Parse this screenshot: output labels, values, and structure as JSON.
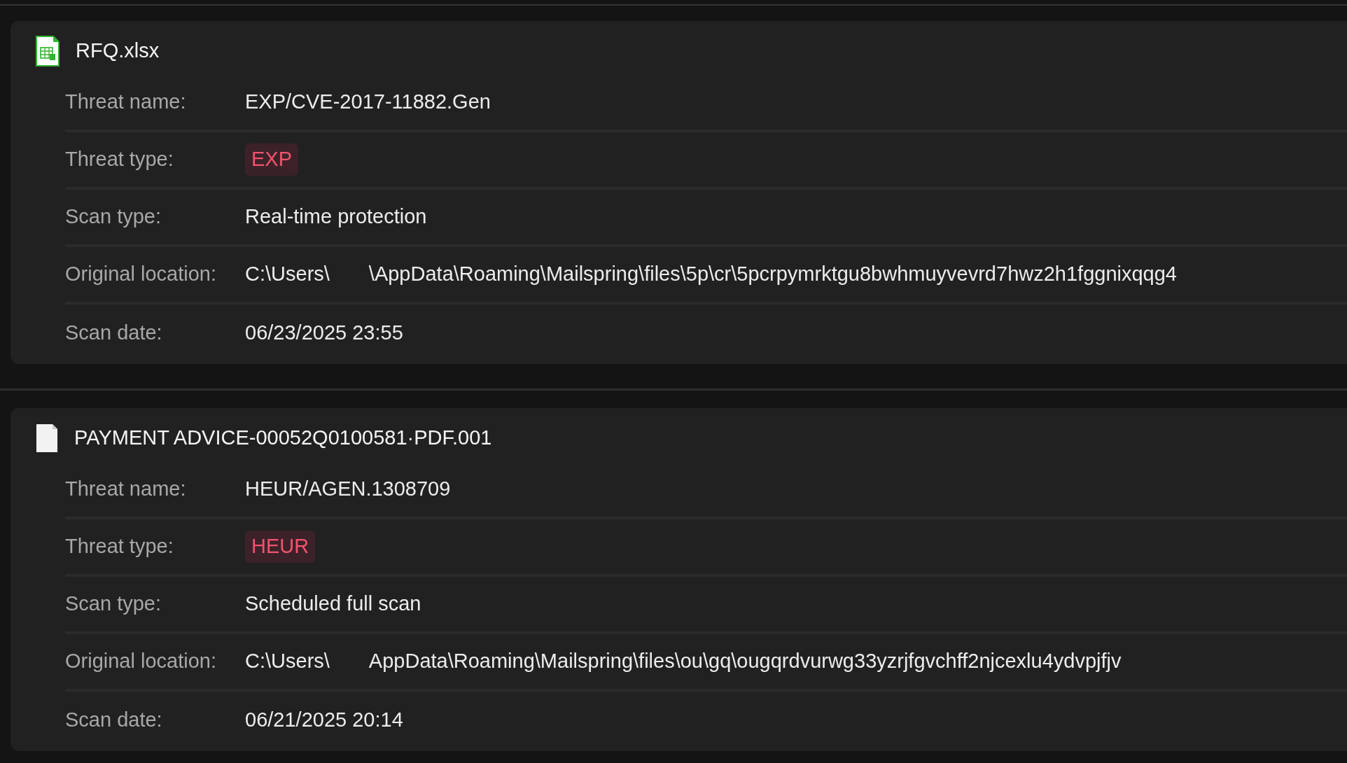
{
  "items": [
    {
      "file_name": "RFQ.xlsx",
      "kind": "spreadsheet",
      "fields": [
        {
          "label": "Threat name:",
          "kind": "text",
          "value": "EXP/CVE-2017-11882.Gen"
        },
        {
          "label": "Threat type:",
          "kind": "tag",
          "value": "EXP"
        },
        {
          "label": "Scan type:",
          "kind": "text",
          "value": "Real-time protection"
        },
        {
          "label": "Original location:",
          "kind": "path",
          "value": "C:\\Users\\",
          "value_end": "\\AppData\\Roaming\\Mailspring\\files\\5p\\cr\\5pcrpymrktgu8bwhmuyvevrd7hwz2h1fggnixqqg4"
        },
        {
          "label": "Scan date:",
          "kind": "text",
          "value": "06/23/2025 23:55"
        }
      ]
    },
    {
      "file_name": "PAYMENT ADVICE-00052Q0100581·PDF.001",
      "kind": "document",
      "fields": [
        {
          "label": "Threat name:",
          "kind": "text",
          "value": "HEUR/AGEN.1308709"
        },
        {
          "label": "Threat type:",
          "kind": "tag",
          "value": "HEUR"
        },
        {
          "label": "Scan type:",
          "kind": "text",
          "value": "Scheduled full scan"
        },
        {
          "label": "Original location:",
          "kind": "path",
          "value": "C:\\Users\\",
          "value_end": "AppData\\Roaming\\Mailspring\\files\\ou\\gq\\ougqrdvurwg33yzrjfgvchff2njcexlu4ydvpjfjv"
        },
        {
          "label": "Scan date:",
          "kind": "text",
          "value": "06/21/2025 20:14"
        }
      ]
    }
  ]
}
